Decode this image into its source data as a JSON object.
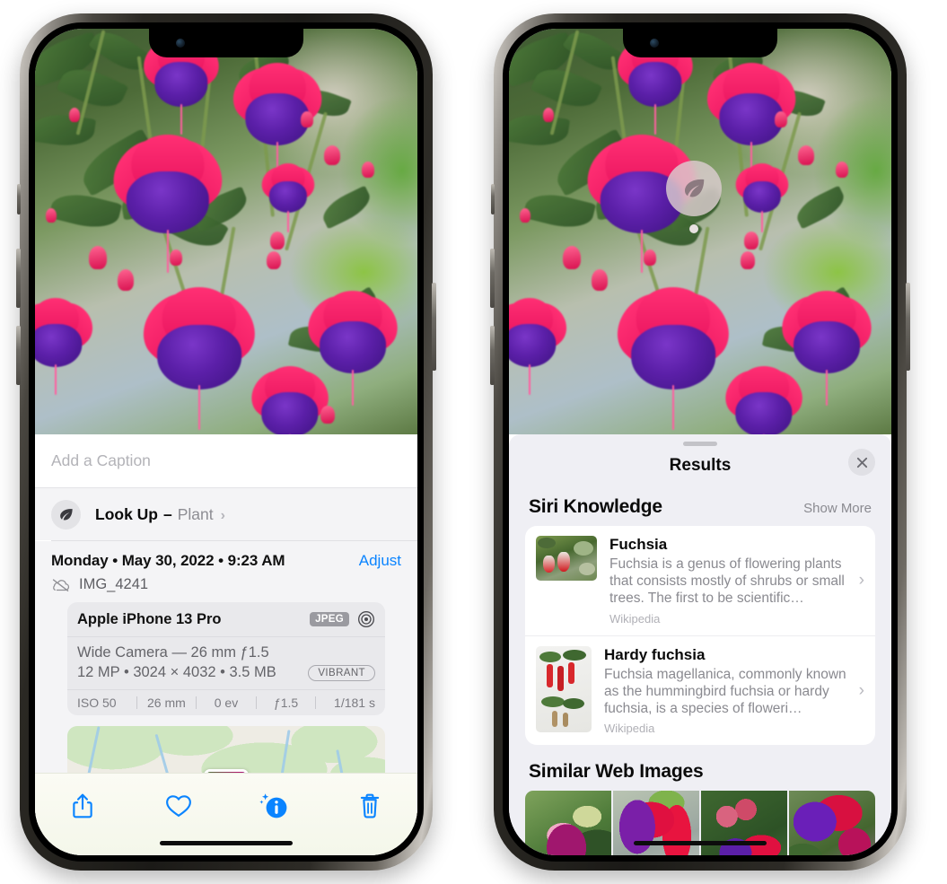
{
  "left_phone": {
    "name": "photos-detail-screen",
    "caption": {
      "placeholder": "Add a Caption",
      "value": ""
    },
    "look_up": {
      "label": "Look Up",
      "dash": "–",
      "subject": "Plant",
      "chevron": "›",
      "icon": "leaf-icon"
    },
    "meta": {
      "date_line": "Monday • May 30, 2022 • 9:23 AM",
      "adjust_label": "Adjust",
      "filename": "IMG_4241",
      "cloud_icon": "icloud-slash-icon"
    },
    "exif": {
      "model": "Apple iPhone 13 Pro",
      "format_badge": "JPEG",
      "aperture_icon": "aperture-icon",
      "lens": "Wide Camera — 26 mm ƒ1.5",
      "size_line": "12 MP • 3024 × 4032 • 3.5 MB",
      "style_badge": "VIBRANT",
      "stats": [
        "ISO 50",
        "26 mm",
        "0 ev",
        "ƒ1.5",
        "1/181 s"
      ]
    },
    "toolbar": [
      {
        "name": "share-button",
        "icon": "share-icon",
        "label": "Share"
      },
      {
        "name": "favorite-button",
        "icon": "heart-icon",
        "label": "Favorite"
      },
      {
        "name": "info-button",
        "icon": "info-sparkle-icon",
        "label": "Info"
      },
      {
        "name": "delete-button",
        "icon": "trash-icon",
        "label": "Delete"
      }
    ],
    "colors": {
      "accent": "#0a84ff",
      "toolbar_bg": "#f7f9ee",
      "sheet_bg": "#f4f4f6"
    }
  },
  "right_phone": {
    "name": "visual-look-up-results-screen",
    "badge": {
      "icon": "leaf-icon",
      "name": "visual-look-up-badge"
    },
    "sheet": {
      "title": "Results",
      "close_label": "✕",
      "sections": [
        {
          "title": "Siri Knowledge",
          "action": "Show More",
          "cards": [
            {
              "title": "Fuchsia",
              "description": "Fuchsia is a genus of flowering plants that consists mostly of shrubs or small trees. The first to be scientific…",
              "source": "Wikipedia",
              "chevron": "›"
            },
            {
              "title": "Hardy fuchsia",
              "description": "Fuchsia magellanica, commonly known as the hummingbird fuchsia or hardy fuchsia, is a species of floweri…",
              "source": "Wikipedia",
              "chevron": "›"
            }
          ]
        },
        {
          "title": "Similar Web Images",
          "action": "",
          "thumbnails": [
            "similar-web-image-1",
            "similar-web-image-2",
            "similar-web-image-3",
            "similar-web-image-4"
          ]
        }
      ]
    },
    "colors": {
      "sheet_bg": "#efeff4",
      "card_bg": "#ffffff",
      "muted_text": "#8a8a90"
    }
  }
}
